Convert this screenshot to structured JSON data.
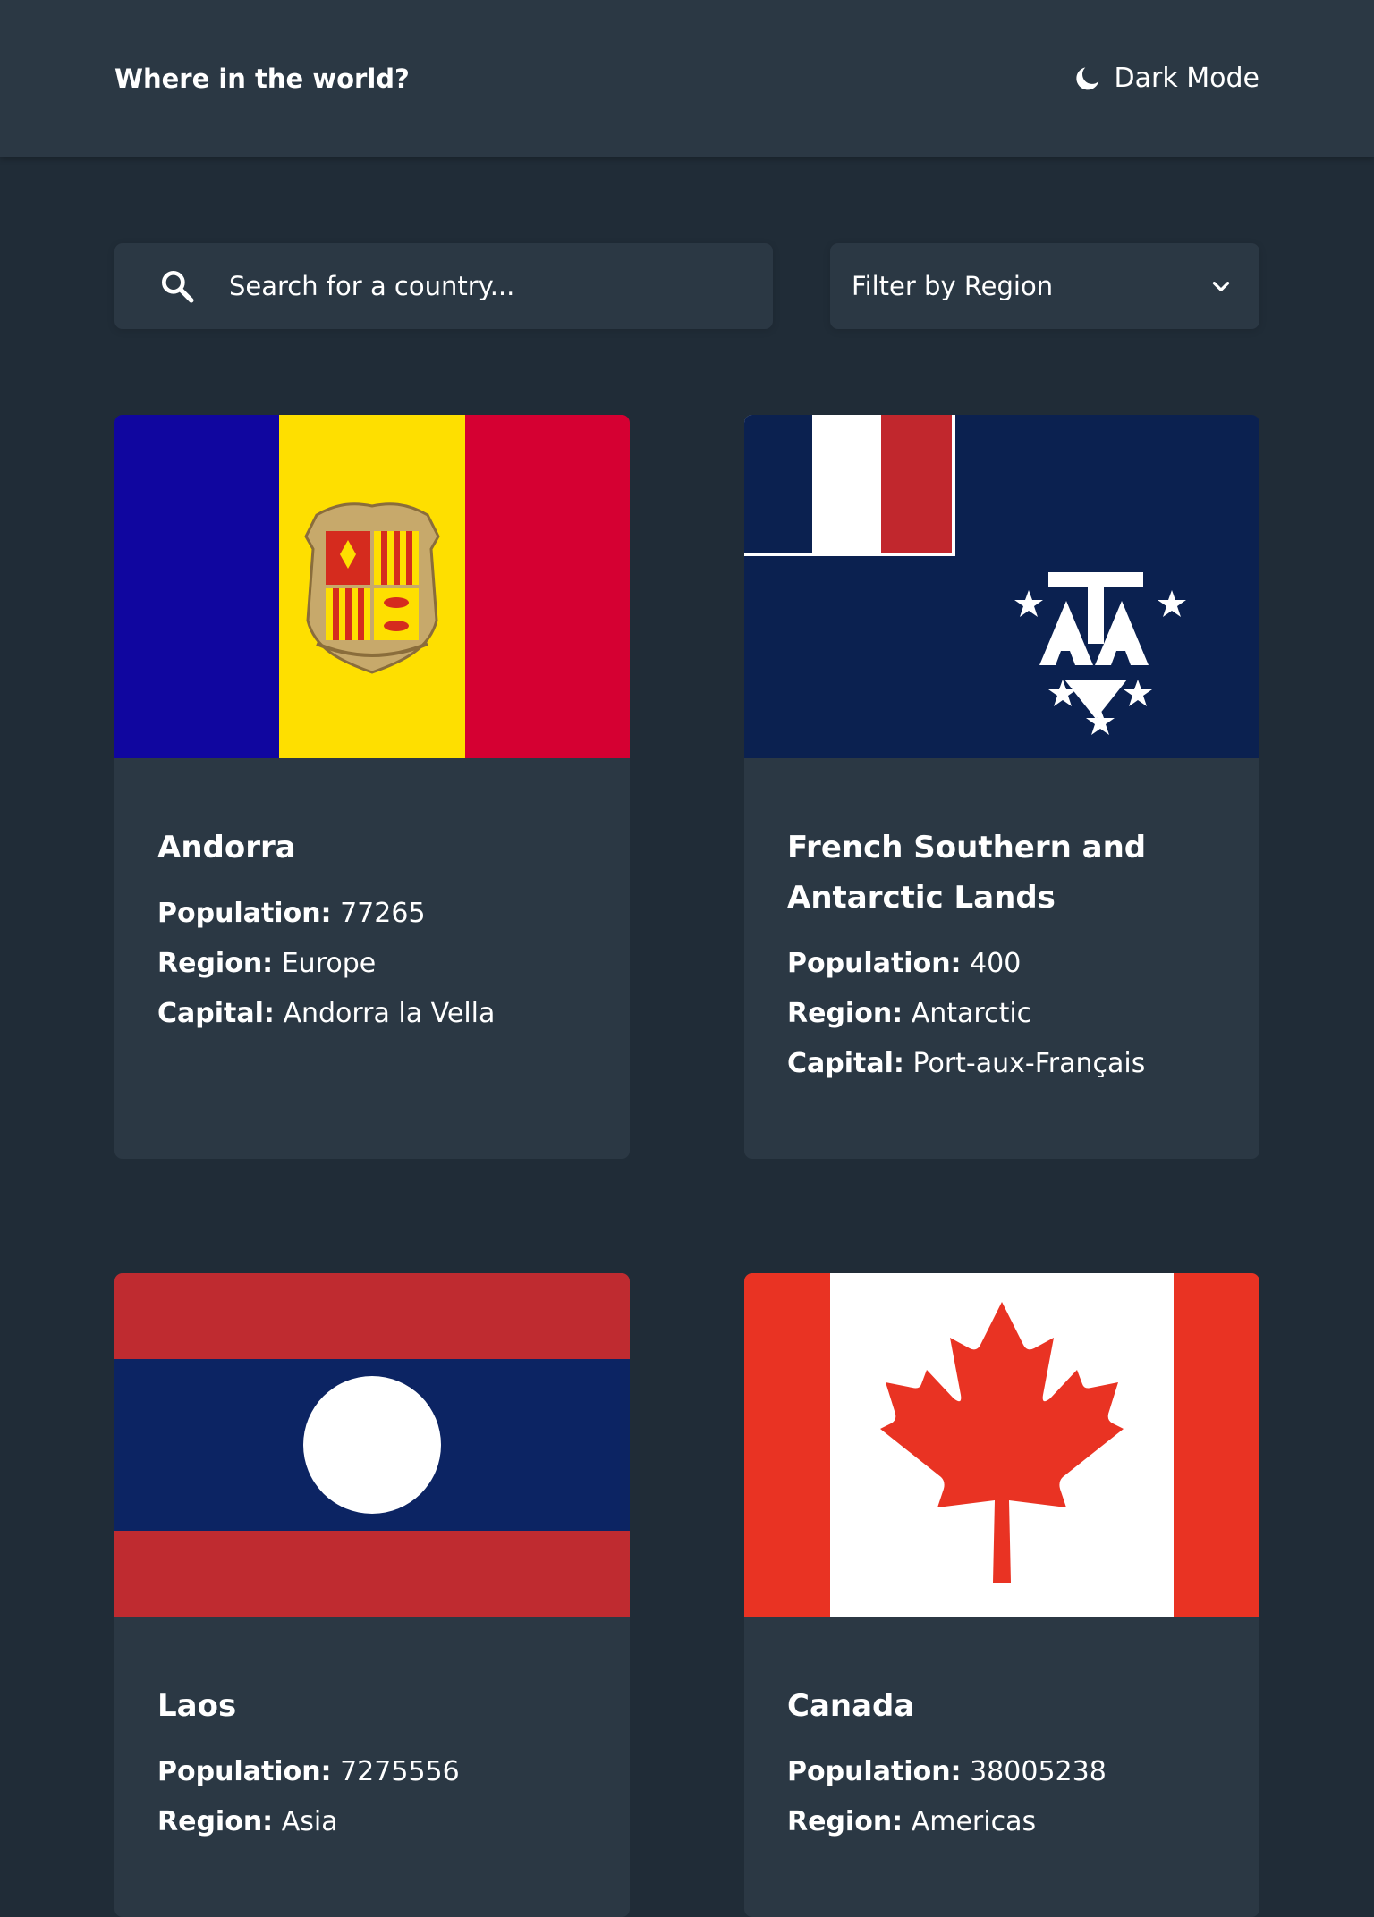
{
  "header": {
    "title": "Where in the world?",
    "mode_label": "Dark Mode",
    "mode_icon": "moon-icon"
  },
  "controls": {
    "search_placeholder": "Search for a country...",
    "search_icon": "search-icon",
    "filter_label": "Filter by Region",
    "filter_icon": "chevron-down-icon"
  },
  "labels": {
    "population": "Population:",
    "region": "Region:",
    "capital": "Capital:"
  },
  "countries": [
    {
      "name": "Andorra",
      "population": "77265",
      "region": "Europe",
      "capital": "Andorra la Vella",
      "flag": "andorra-flag"
    },
    {
      "name": "French Southern and Antarctic Lands",
      "population": "400",
      "region": "Antarctic",
      "capital": "Port-aux-Français",
      "flag": "french-southern-antarctic-lands-flag"
    },
    {
      "name": "Laos",
      "population": "7275556",
      "region": "Asia",
      "capital": "",
      "flag": "laos-flag"
    },
    {
      "name": "Canada",
      "population": "38005238",
      "region": "Americas",
      "capital": "",
      "flag": "canada-flag"
    }
  ],
  "colors": {
    "background": "#202c37",
    "surface": "#2b3844",
    "text": "#ffffff"
  }
}
